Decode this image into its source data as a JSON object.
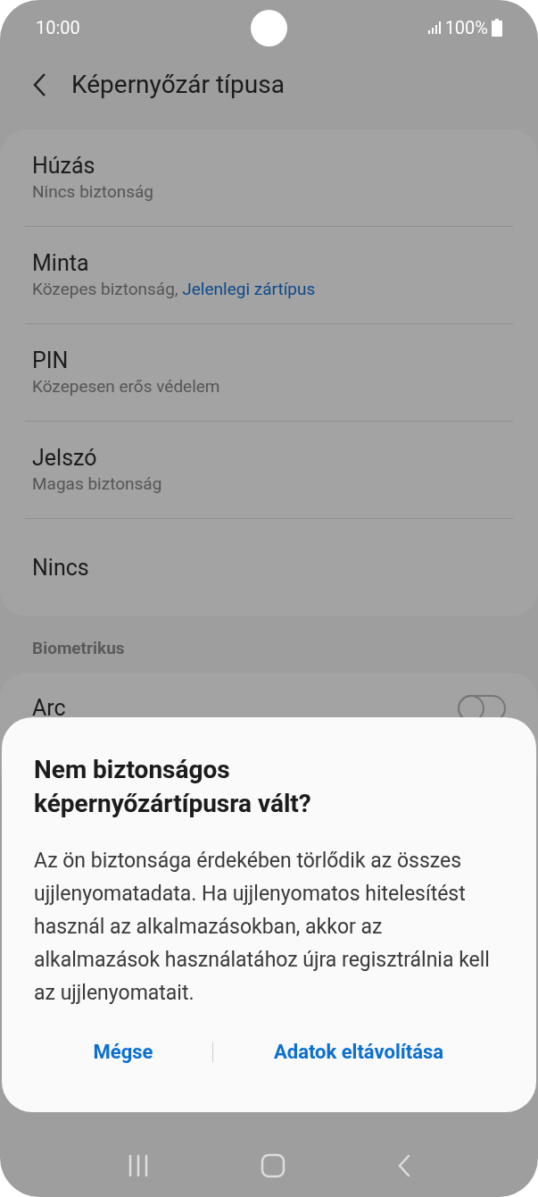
{
  "status_bar": {
    "time": "10:00",
    "battery": "100%"
  },
  "header": {
    "title": "Képernyőzár típusa"
  },
  "lock_types": [
    {
      "title": "Húzás",
      "subtitle": "Nincs biztonság"
    },
    {
      "title": "Minta",
      "subtitle": "Közepes biztonság, ",
      "current": "Jelenlegi zártípus"
    },
    {
      "title": "PIN",
      "subtitle": "Közepesen erős védelem"
    },
    {
      "title": "Jelszó",
      "subtitle": "Magas biztonság"
    },
    {
      "title": "Nincs"
    }
  ],
  "biometrics": {
    "heading": "Biometrikus",
    "items": [
      {
        "title": "Arc",
        "on": false
      }
    ]
  },
  "dialog": {
    "title": "Nem biztonságos képernyőzártípusra vált?",
    "message": "Az ön biztonsága érdekében törlődik az összes ujjlenyomatadata. Ha ujjlenyomatos hitelesítést használ az alkalmazásokban, akkor az alkalmazások használatához újra regisztrálnia kell az ujjlenyomatait.",
    "buttons": [
      "Mégse",
      "Adatok eltávolítása"
    ]
  }
}
